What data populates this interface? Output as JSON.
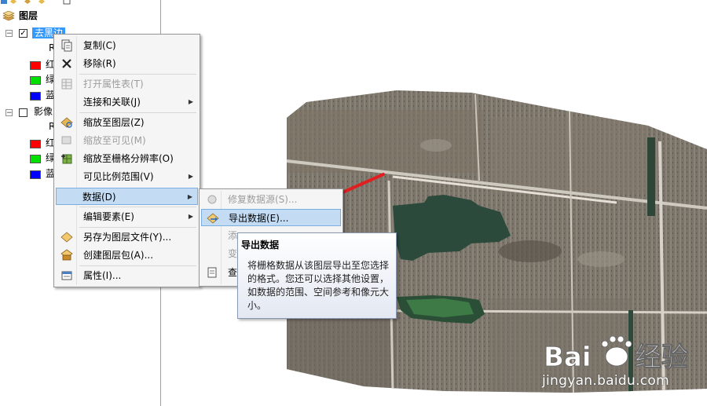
{
  "toc": {
    "root_label": "图层",
    "layer1": {
      "name": "去黑边",
      "checked": true,
      "rgb_label": "R",
      "bands": [
        {
          "label": "红",
          "color": "#ff0000"
        },
        {
          "label": "绿",
          "color": "#00e000"
        },
        {
          "label": "蓝",
          "color": "#0000ff"
        }
      ]
    },
    "layer2": {
      "name": "影像",
      "checked": false,
      "rgb_label": "R",
      "bands": [
        {
          "label": "红",
          "color": "#ff0000"
        },
        {
          "label": "绿",
          "color": "#00e000"
        },
        {
          "label": "蓝",
          "color": "#0000ff"
        }
      ]
    }
  },
  "context_menu": {
    "copy": "复制(C)",
    "remove": "移除(R)",
    "open_table": "打开属性表(T)",
    "joins": "连接和关联(J)",
    "zoom_layer": "缩放至图层(Z)",
    "zoom_visible": "缩放至可见(M)",
    "zoom_raster": "缩放至栅格分辨率(O)",
    "visible_scale": "可见比例范围(V)",
    "data": "数据(D)",
    "edit_features": "编辑要素(E)",
    "save_layer_file": "另存为图层文件(Y)...",
    "create_package": "创建图层包(A)...",
    "properties": "属性(I)..."
  },
  "sub_menu": {
    "repair_source": "修复数据源(S)...",
    "export_data": "导出数据(E)...",
    "item3": "添",
    "item4": "变",
    "item5": "查"
  },
  "tooltip": {
    "title": "导出数据",
    "body": "将栅格数据从该图层导出至您选择的格式。您还可以选择其他设置，如数据的范围、空间参考和像元大小。"
  },
  "watermark": {
    "url": "jingyan.baidu.com"
  },
  "colors": {
    "menu_highlight": "#c3dcf4",
    "selection": "#3399ff",
    "arrow": "#e02020"
  }
}
